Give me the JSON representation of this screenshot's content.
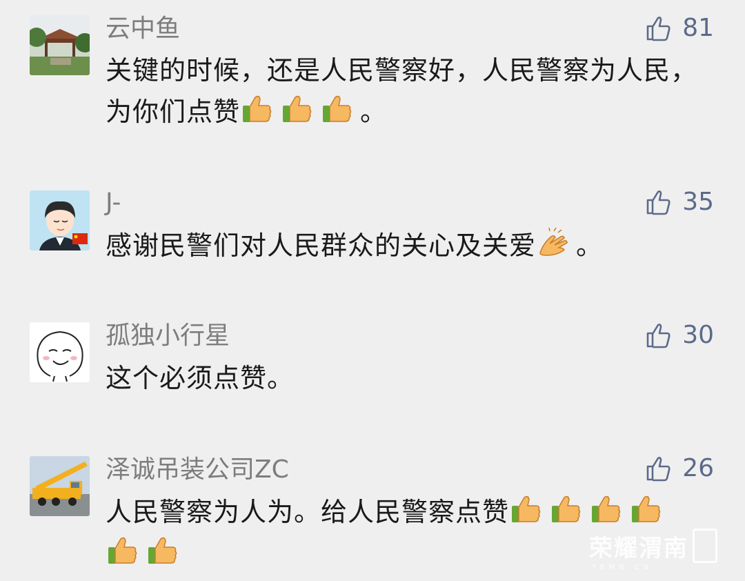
{
  "comments": [
    {
      "username": "云中鱼",
      "likes": "81",
      "text": "关键的时候，还是人民警察好，人民警察为人民，为你们点赞",
      "emoji_count": 3,
      "emoji": "thumbs-up-icon",
      "suffix": "。",
      "avatar": "garden-pavilion-photo"
    },
    {
      "username": "J-",
      "likes": "35",
      "text": "感谢民警们对人民群众的关心及关爱",
      "emoji_count": 1,
      "emoji": "clapping-hands-icon",
      "suffix": "。",
      "avatar": "cartoon-boy-with-flag"
    },
    {
      "username": "孤独小行星",
      "likes": "30",
      "text": "这个必须点赞。",
      "emoji_count": 0,
      "emoji": "",
      "suffix": "",
      "avatar": "doodle-smiling-face"
    },
    {
      "username": "泽诚吊装公司ZC",
      "likes": "26",
      "text": "人民警察为人为。给人民警察点赞",
      "emoji_count": 6,
      "emoji": "thumbs-up-icon",
      "suffix": "",
      "avatar": "crane-truck-photo"
    }
  ],
  "colors": {
    "background": "#efefef",
    "username": "#7d7d7d",
    "likes": "#5b6a8a",
    "text": "#1a1a1a"
  },
  "watermark": {
    "text": "荣耀渭南",
    "sub": "YEMN.CN"
  }
}
